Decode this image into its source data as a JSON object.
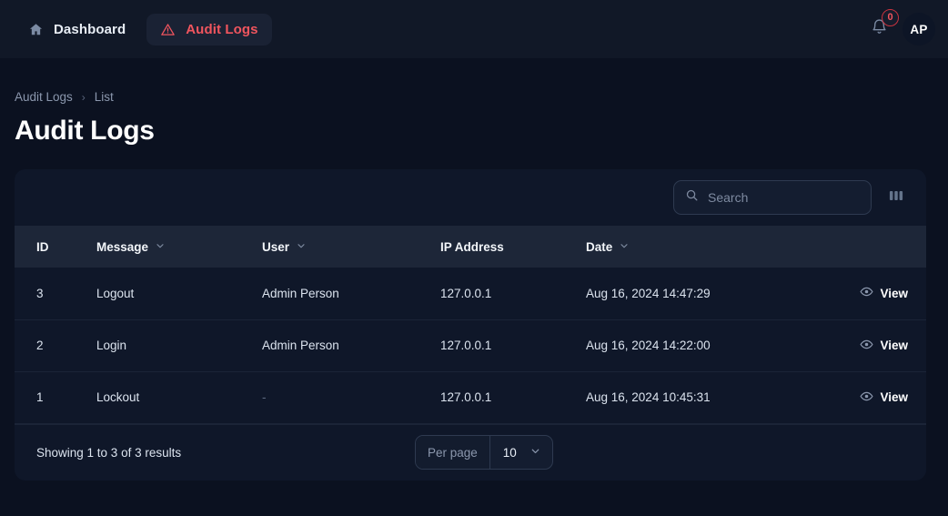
{
  "topnav": {
    "dashboard_label": "Dashboard",
    "audit_logs_label": "Audit Logs",
    "notification_count": "0",
    "avatar_initials": "AP",
    "active_accent": "#f0555e"
  },
  "breadcrumb": {
    "parent": "Audit Logs",
    "separator": "›",
    "current": "List"
  },
  "page": {
    "title": "Audit Logs"
  },
  "toolbar": {
    "search_placeholder": "Search",
    "search_value": ""
  },
  "table": {
    "columns": [
      {
        "label": "ID",
        "sortable": false
      },
      {
        "label": "Message",
        "sortable": true
      },
      {
        "label": "User",
        "sortable": true
      },
      {
        "label": "IP Address",
        "sortable": false
      },
      {
        "label": "Date",
        "sortable": true
      }
    ],
    "rows": [
      {
        "id": "3",
        "message": "Logout",
        "user": "Admin Person",
        "ip": "127.0.0.1",
        "date": "Aug 16, 2024 14:47:29",
        "action": "View"
      },
      {
        "id": "2",
        "message": "Login",
        "user": "Admin Person",
        "ip": "127.0.0.1",
        "date": "Aug 16, 2024 14:22:00",
        "action": "View"
      },
      {
        "id": "1",
        "message": "Lockout",
        "user": "-",
        "ip": "127.0.0.1",
        "date": "Aug 16, 2024 10:45:31",
        "action": "View"
      }
    ]
  },
  "footer": {
    "results_text": "Showing 1 to 3 of 3 results",
    "per_page_label": "Per page",
    "per_page_value": "10"
  }
}
